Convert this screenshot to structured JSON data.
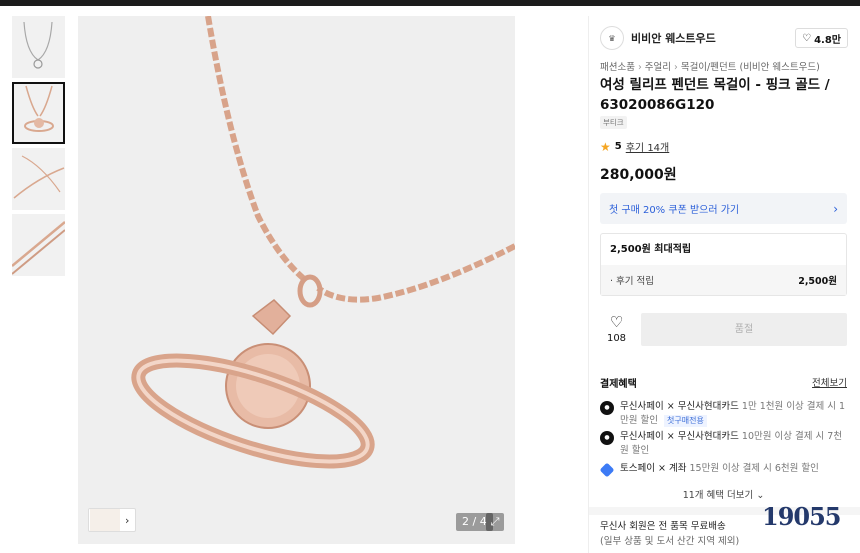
{
  "gallery": {
    "thumbnails": [
      {
        "name": "thumb-necklace-silver"
      },
      {
        "name": "thumb-pendant-closeup",
        "active": true
      },
      {
        "name": "thumb-chain-detail"
      },
      {
        "name": "thumb-chain-macro"
      }
    ],
    "counter": "2 / 4"
  },
  "brand": {
    "name": "비비안 웨스트우드",
    "likes": "4.8만"
  },
  "breadcrumb": [
    "패션소품",
    "주얼리",
    "목걸이/펜던트 (비비안 웨스트우드)"
  ],
  "product": {
    "title": "여성 릴리프 펜던트 목걸이 - 핑크 골드 / 63020086G120",
    "tag": "부티크",
    "rating": "5",
    "reviews": "후기 14개",
    "price": "280,000원"
  },
  "coupon": {
    "label": "첫 구매 20% 쿠폰 받으러 가기"
  },
  "points": {
    "header": "2,500원 최대적립",
    "row_label": "· 후기 적립",
    "row_amount": "2,500원"
  },
  "actions": {
    "wish_count": "108",
    "soldout_label": "품절"
  },
  "benefits": {
    "title": "결제혜택",
    "view_all": "전체보기",
    "items": [
      {
        "brand": "무신사페이 × 무신사현대카드",
        "desc": "1만 1천원 이상 결제 시 1만원 할인",
        "badge": "첫구매전용"
      },
      {
        "brand": "무신사페이 × 무신사현대카드",
        "desc": "10만원 이상 결제 시 7천원 할인"
      },
      {
        "brand": "토스페이 × 계좌",
        "desc": "15만원 이상 결제 시 6천원 할인"
      }
    ],
    "more": "11개 혜택 더보기"
  },
  "shipping": {
    "line1": "무신사 회원은 전 품목 무료배송",
    "line2": "(일부 상품 및 도서 산간 지역 제외)"
  },
  "watermark": "19055",
  "colors": {
    "rose_gold": "#d9a88f",
    "accent_blue": "#2b5fd9",
    "star": "#f5a623"
  }
}
